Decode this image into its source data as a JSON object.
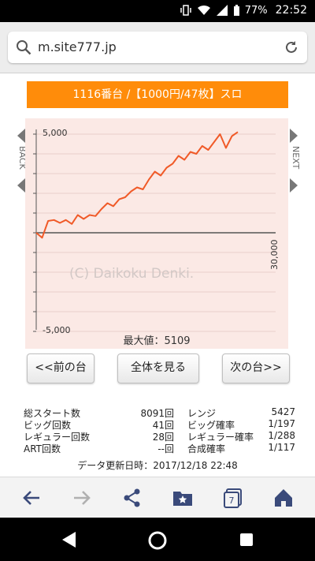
{
  "status": {
    "battery": "77%",
    "time": "22:52"
  },
  "browser": {
    "url": "m.site777.jp"
  },
  "header": {
    "title": "1116番台 /【1000円/47枚】スロ"
  },
  "chart_data": {
    "type": "line",
    "title": "",
    "xlabel": "",
    "ylabel": "",
    "x_tick_label": "30,000",
    "y_tick_labels": [
      "5,000",
      "-5,000"
    ],
    "ylim": [
      -5000,
      5000
    ],
    "watermark": "(C) Daikoku Denki.",
    "max_label": "最大値：5109",
    "series": [
      {
        "values": [
          0,
          -250,
          600,
          650,
          500,
          650,
          450,
          900,
          700,
          900,
          850,
          1200,
          1500,
          1350,
          1700,
          1800,
          2100,
          2300,
          2200,
          2700,
          3100,
          2900,
          3300,
          3500,
          3900,
          3700,
          4100,
          4000,
          4400,
          4200,
          4600,
          5000,
          4300,
          4900,
          5109
        ]
      }
    ]
  },
  "side_nav": {
    "back": "BACK",
    "next": "NEXT"
  },
  "buttons": {
    "prev": "<<前の台",
    "all": "全体を見る",
    "next": "次の台>>"
  },
  "stats": {
    "total_start_label": "総スタート数",
    "total_start_value": "8091回",
    "range_label": "レンジ",
    "range_value": "5427",
    "big_label": "ビッグ回数",
    "big_value": "41回",
    "big_rate_label": "ビッグ確率",
    "big_rate_value": "1/197",
    "reg_label": "レギュラー回数",
    "reg_value": "28回",
    "reg_rate_label": "レギュラー確率",
    "reg_rate_value": "1/288",
    "art_label": "ART回数",
    "art_value": "--回",
    "combined_label": "合成確率",
    "combined_value": "1/117"
  },
  "updated": "データ更新日時：2017/12/18 22:48",
  "colors": {
    "accent": "#ff8c0a",
    "line": "#f05a28",
    "chart_bg": "#fbe9e5"
  }
}
